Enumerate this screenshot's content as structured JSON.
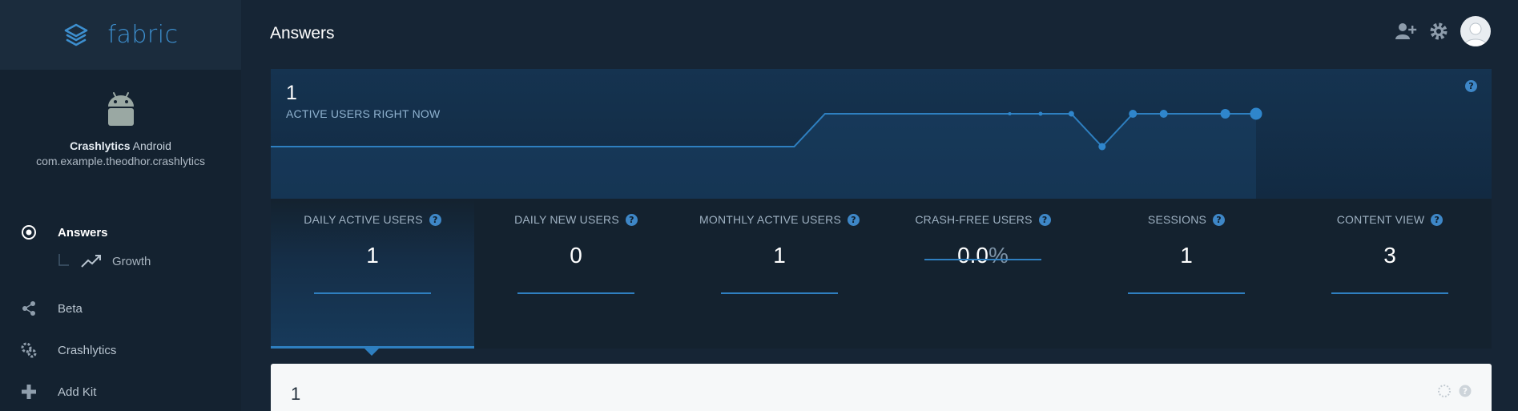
{
  "brand": {
    "name": "fabric",
    "accent": "#3d8fcf"
  },
  "app": {
    "name_bold": "Crashlytics",
    "name_rest": " Android",
    "package": "com.example.theodhor.crashlytics",
    "icon": "android-icon"
  },
  "nav": {
    "items": [
      {
        "label": "Answers",
        "icon": "radio-dot-icon",
        "active": true
      },
      {
        "label": "Beta",
        "icon": "share-nodes-icon"
      },
      {
        "label": "Crashlytics",
        "icon": "gear-cluster-icon"
      },
      {
        "label": "Add Kit",
        "icon": "plus-icon"
      }
    ],
    "sub": {
      "label": "Growth",
      "icon": "trend-up-icon"
    }
  },
  "header": {
    "title": "Answers",
    "icons": [
      "add-user-icon",
      "gear-icon",
      "avatar"
    ]
  },
  "realtime": {
    "count": "1",
    "label": "ACTIVE USERS RIGHT NOW",
    "series": [
      0,
      0,
      0,
      0,
      0,
      0,
      0,
      0,
      0,
      0,
      0,
      0,
      0,
      0,
      0,
      0,
      0,
      0,
      1,
      1,
      1,
      1,
      1,
      1,
      1,
      1,
      1,
      0,
      1,
      1,
      1,
      1,
      1
    ]
  },
  "metrics": [
    {
      "name": "DAILY ACTIVE USERS",
      "value": "1",
      "suffix": "",
      "selected": true
    },
    {
      "name": "DAILY NEW USERS",
      "value": "0",
      "suffix": ""
    },
    {
      "name": "MONTHLY ACTIVE USERS",
      "value": "1",
      "suffix": ""
    },
    {
      "name": "CRASH-FREE USERS",
      "value": "0.0",
      "suffix": "%"
    },
    {
      "name": "SESSIONS",
      "value": "1",
      "suffix": ""
    },
    {
      "name": "CONTENT VIEW",
      "value": "3",
      "suffix": ""
    }
  ],
  "card": {
    "value": "1",
    "icons": [
      "loading-icon",
      "help-icon"
    ]
  },
  "help_glyph": "?"
}
